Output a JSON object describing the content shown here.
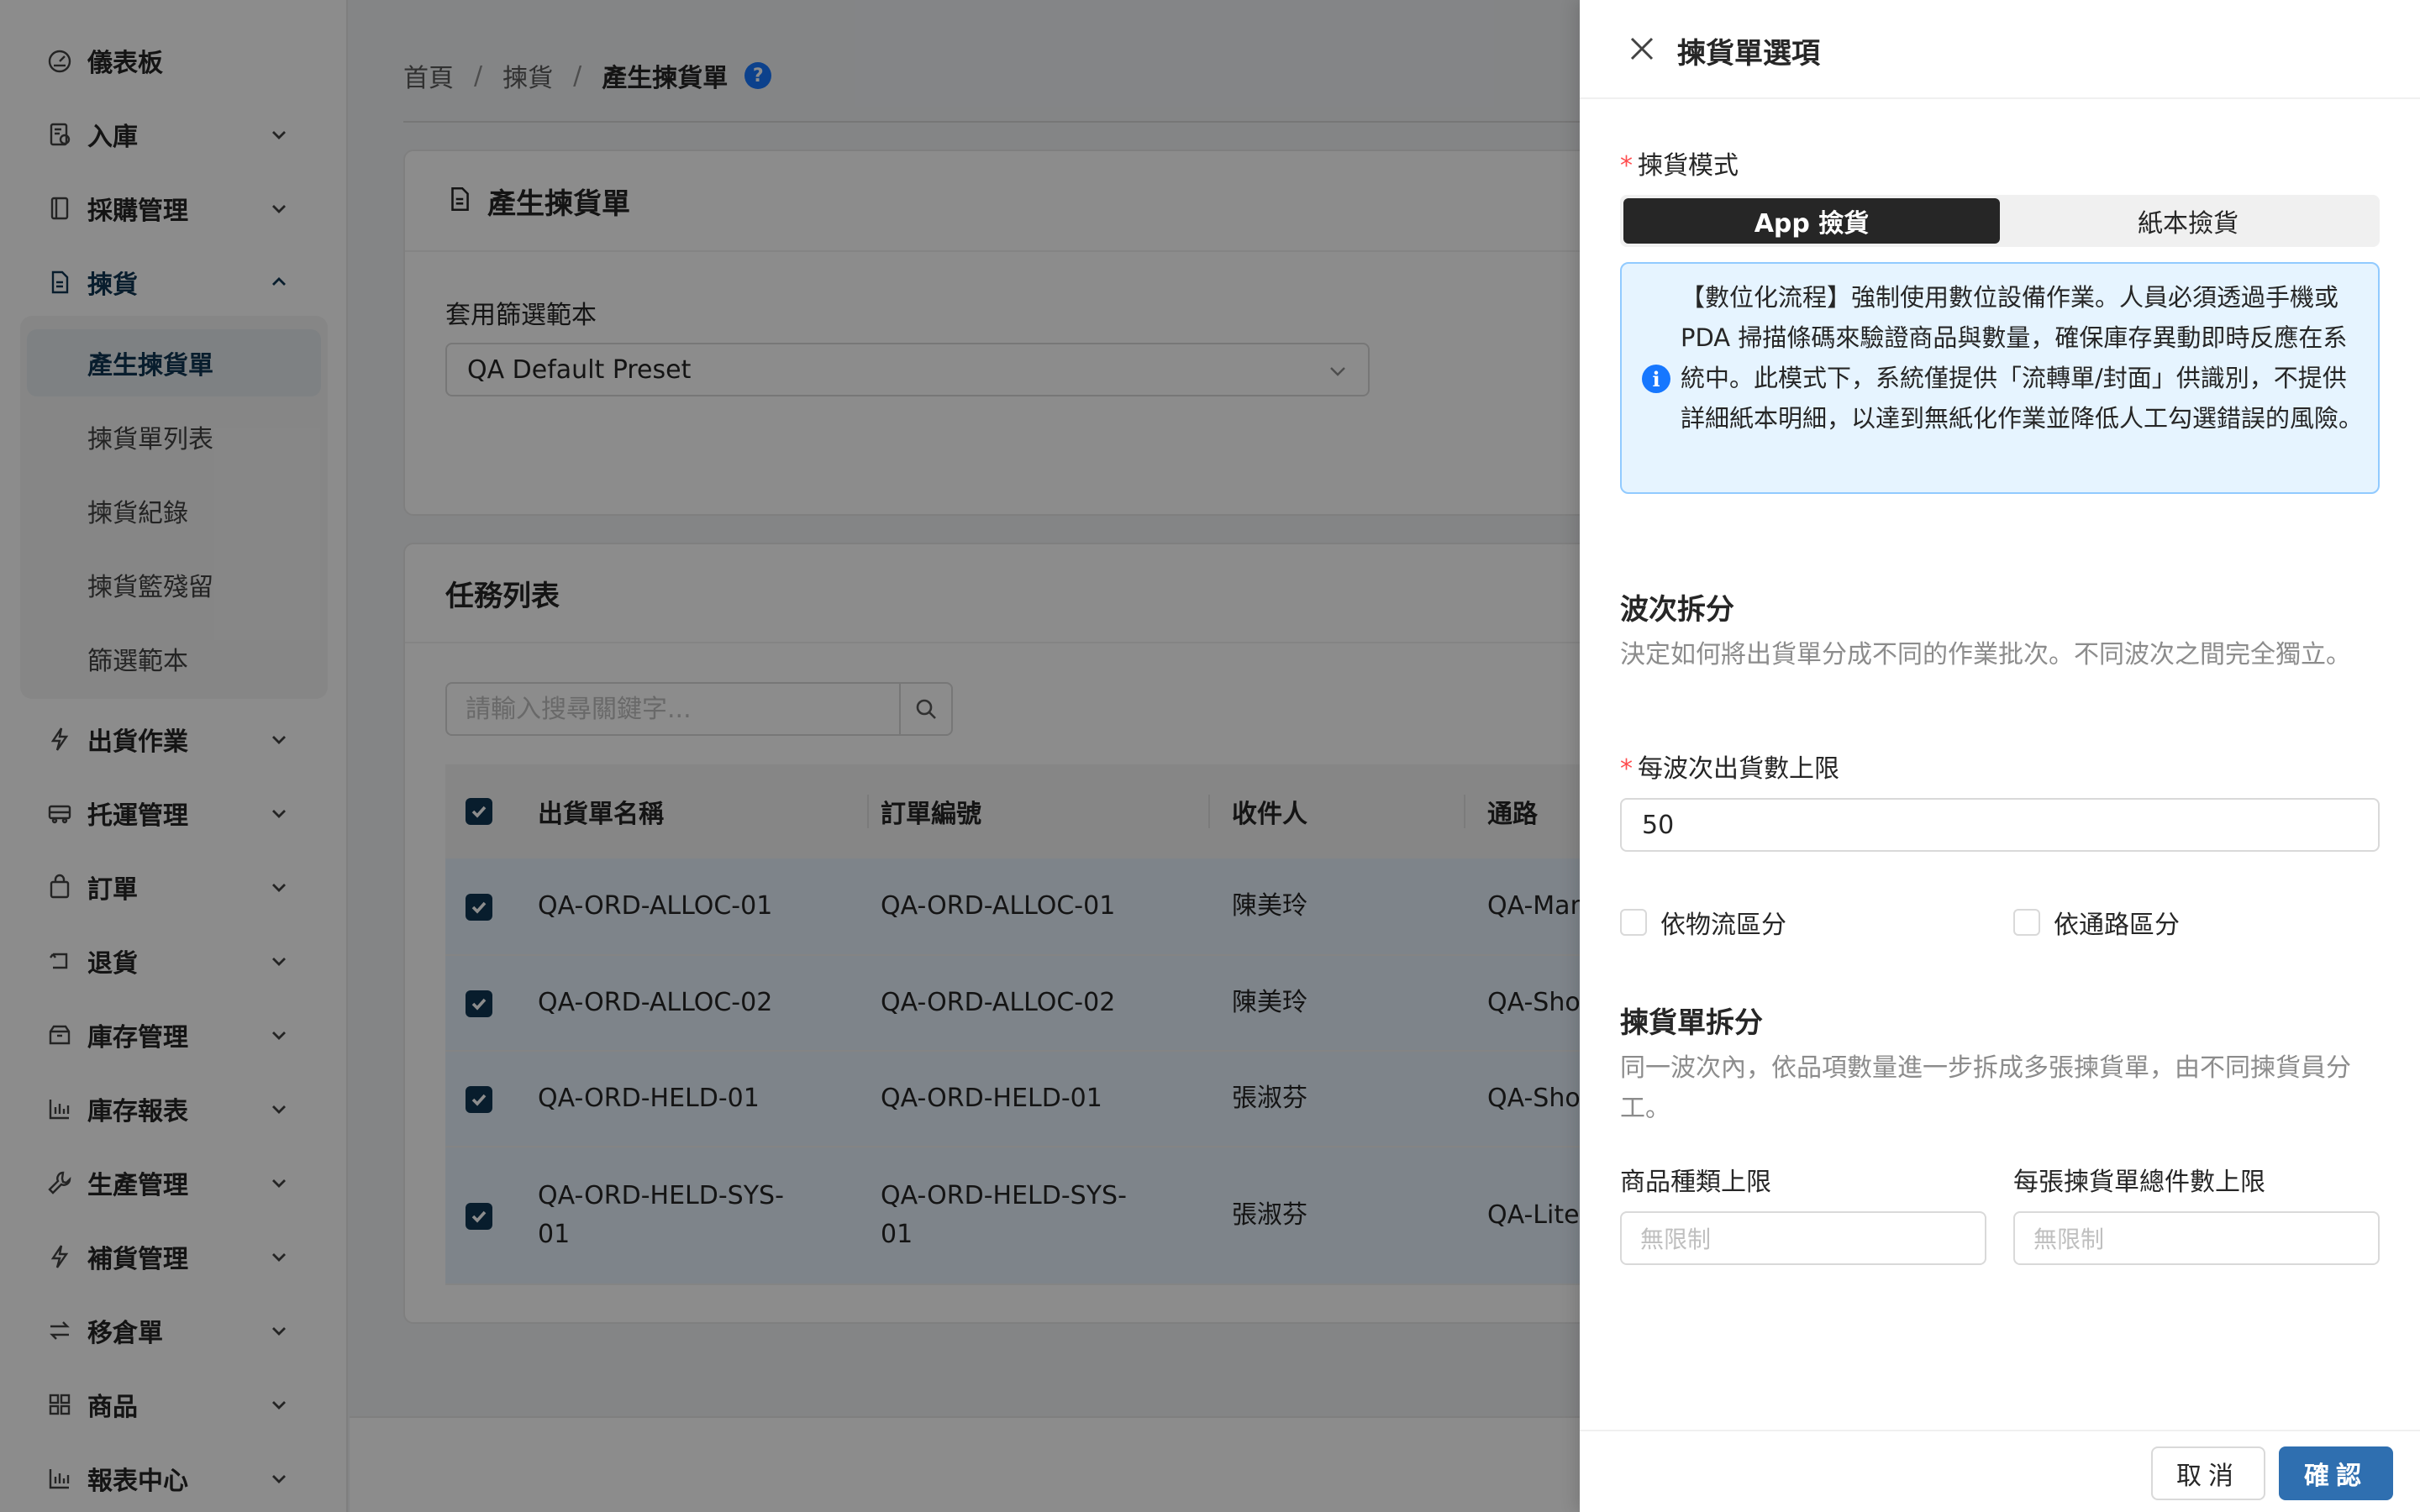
{
  "sidebar": {
    "items": [
      {
        "label": "儀表板",
        "icon": "dashboard-icon"
      },
      {
        "label": "入庫",
        "icon": "inbound-icon"
      },
      {
        "label": "採購管理",
        "icon": "purchase-icon"
      },
      {
        "label": "揀貨",
        "icon": "document-icon"
      },
      {
        "label": "出貨作業",
        "icon": "lightning-icon"
      },
      {
        "label": "托運管理",
        "icon": "truck-icon"
      },
      {
        "label": "訂單",
        "icon": "bag-icon"
      },
      {
        "label": "退貨",
        "icon": "return-icon"
      },
      {
        "label": "庫存管理",
        "icon": "inventory-icon"
      },
      {
        "label": "庫存報表",
        "icon": "bar-chart-icon"
      },
      {
        "label": "生產管理",
        "icon": "wrench-icon"
      },
      {
        "label": "補貨管理",
        "icon": "lightning-icon"
      },
      {
        "label": "移倉單",
        "icon": "transfer-icon"
      },
      {
        "label": "商品",
        "icon": "grid-icon"
      },
      {
        "label": "報表中心",
        "icon": "bar-chart-icon"
      }
    ],
    "submenu": [
      "產生揀貨單",
      "揀貨單列表",
      "揀貨紀錄",
      "揀貨籃殘留",
      "篩選範本"
    ]
  },
  "breadcrumb": {
    "home": "首頁",
    "parent": "揀貨",
    "current": "產生揀貨單",
    "sep": "/"
  },
  "gen_card": {
    "title": "產生揀貨單",
    "preset_label": "套用篩選範本",
    "preset_value": "QA Default Preset"
  },
  "tasks_card": {
    "title": "任務列表",
    "search_placeholder": "請輸入搜尋關鍵字...",
    "columns": [
      "出貨單名稱",
      "訂單編號",
      "收件人",
      "通路"
    ],
    "rows": [
      {
        "name": "QA-ORD-ALLOC-01",
        "order": "QA-ORD-ALLOC-01",
        "recipient": "陳美玲",
        "channel": "QA-Manual"
      },
      {
        "name": "QA-ORD-ALLOC-02",
        "order": "QA-ORD-ALLOC-02",
        "recipient": "陳美玲",
        "channel": "QA-Shopify"
      },
      {
        "name": "QA-ORD-HELD-01",
        "order": "QA-ORD-HELD-01",
        "recipient": "張淑芬",
        "channel": "QA-Shopify"
      },
      {
        "name": "QA-ORD-HELD-SYS-01",
        "order": "QA-ORD-HELD-SYS-01",
        "recipient": "張淑芬",
        "channel": "QA-Liteshop"
      }
    ]
  },
  "drawer": {
    "title": "揀貨單選項",
    "mode_label": "揀貨模式",
    "mode_options": [
      "App 撿貨",
      "紙本撿貨"
    ],
    "mode_selected": "App 撿貨",
    "info_text": "【數位化流程】強制使用數位設備作業。人員必須透過手機或 PDA 掃描條碼來驗證商品與數量，確保庫存異動即時反應在系統中。此模式下，系統僅提供「流轉單/封面」供識別，不提供詳細紙本明細，以達到無紙化作業並降低人工勾選錯誤的風險。",
    "wave": {
      "title": "波次拆分",
      "desc": "決定如何將出貨單分成不同的作業批次。不同波次之間完全獨立。",
      "limit_label": "每波次出貨數上限",
      "limit_value": "50",
      "by_logistics": "依物流區分",
      "by_channel": "依通路區分"
    },
    "split": {
      "title": "揀貨單拆分",
      "desc": "同一波次內，依品項數量進一步拆成多張揀貨單，由不同揀貨員分工。",
      "sku_limit_label": "商品種類上限",
      "sku_limit_placeholder": "無限制",
      "qty_limit_label": "每張揀貨單總件數上限",
      "qty_limit_placeholder": "無限制"
    },
    "cancel_label": "取消",
    "ok_label": "確認"
  },
  "colors": {
    "primary": "#0f3552",
    "accent": "#2f6fb0",
    "info_bg": "#e6f4ff",
    "required": "#ff4d4f"
  }
}
